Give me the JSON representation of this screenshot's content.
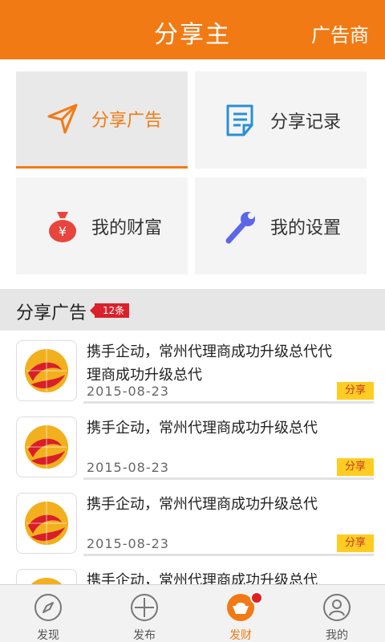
{
  "header": {
    "title": "分享主",
    "right_label": "广告商"
  },
  "tiles": [
    {
      "label": "分享广告",
      "icon": "paper-plane-icon",
      "active": true
    },
    {
      "label": "分享记录",
      "icon": "document-icon",
      "active": false
    },
    {
      "label": "我的财富",
      "icon": "money-bag-icon",
      "active": false
    },
    {
      "label": "我的设置",
      "icon": "wrench-icon",
      "active": false
    }
  ],
  "section": {
    "title": "分享广告",
    "badge": "12条"
  },
  "list": [
    {
      "title": "携手企动，常州代理商成功升级总代代理商成功升级总代",
      "date": "2015-08-23",
      "action": "分享"
    },
    {
      "title": "携手企动，常州代理商成功升级总代",
      "date": "2015-08-23",
      "action": "分享"
    },
    {
      "title": "携手企动，常州代理商成功升级总代",
      "date": "2015-08-23",
      "action": "分享"
    },
    {
      "title": "携手企动，常州代理商成功升级总代",
      "date": "",
      "action": ""
    }
  ],
  "tabbar": [
    {
      "label": "发现",
      "icon": "compass-icon"
    },
    {
      "label": "发布",
      "icon": "plus-circle-icon"
    },
    {
      "label": "发财",
      "icon": "gold-ingot-icon",
      "active": true
    },
    {
      "label": "我的",
      "icon": "user-icon"
    }
  ],
  "colors": {
    "brand": "#f27a14",
    "badge": "#d9212b",
    "share": "#ffcc22"
  }
}
